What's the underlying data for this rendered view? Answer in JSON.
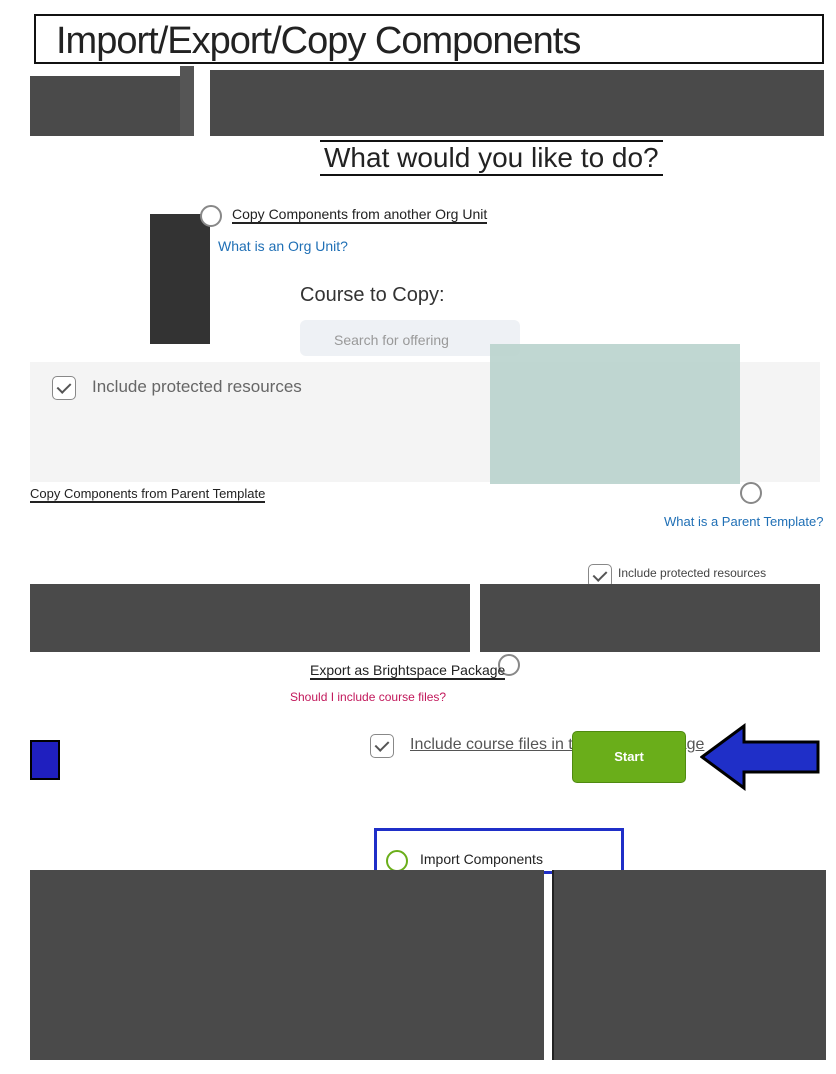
{
  "page_title": "Import/Export/Copy Components",
  "question": "What would you like to do?",
  "options": {
    "copy_org_unit": {
      "label": "Copy Components from another Org Unit",
      "help_link": "What is an Org Unit?",
      "course_to_copy_label": "Course to Copy:",
      "search_placeholder": "Search for offering",
      "include_protected": "Include protected resources"
    },
    "copy_parent_template": {
      "label": "Copy Components from Parent Template",
      "help_link": "What is a Parent Template?",
      "include_protected": "Include protected resources"
    },
    "export_package": {
      "label": "Export as Brightspace Package",
      "help_link": "Should I include course files?",
      "include_files": "Include course files in the export package"
    },
    "import_components": {
      "label": "Import Components"
    }
  },
  "actions": {
    "start_label": "Start"
  },
  "colors": {
    "start_button": "#6aae1a",
    "link": "#1f6fb5",
    "arrow": "#1f2fc8",
    "highlight_border": "#1f2fc8"
  },
  "icons": [
    "checkbox-checked-icon",
    "radio-icon",
    "arrow-left-icon"
  ]
}
